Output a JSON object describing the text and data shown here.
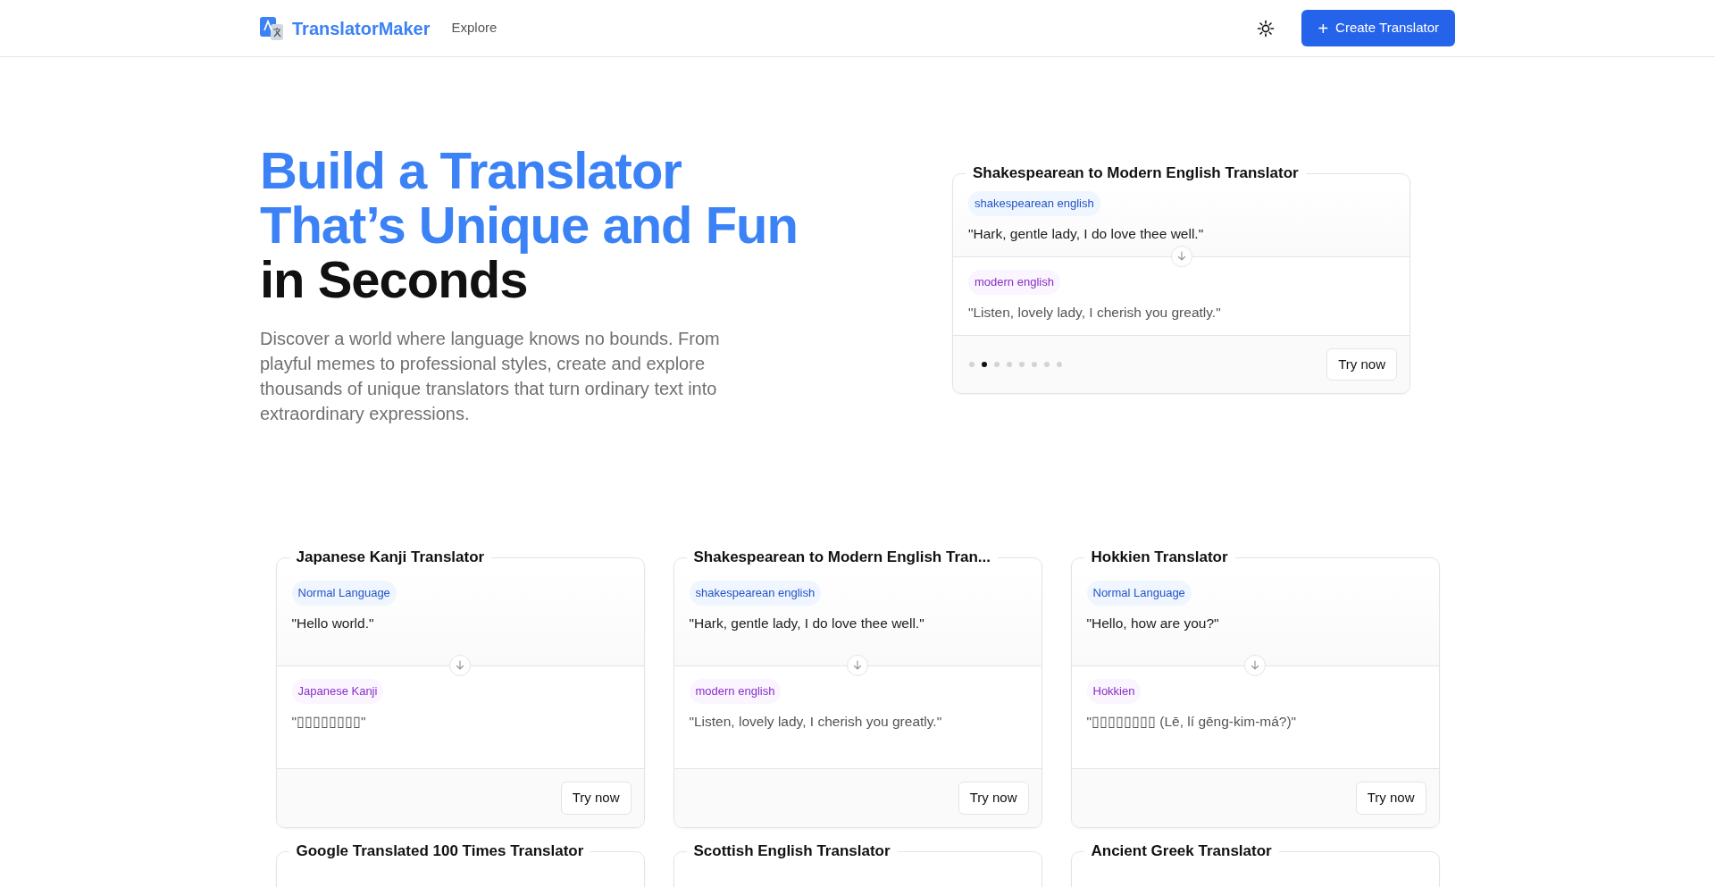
{
  "header": {
    "brand": "TranslatorMaker",
    "nav": [
      {
        "label": "Explore"
      }
    ],
    "create_button": {
      "icon": "+",
      "label": "Create Translator"
    }
  },
  "hero": {
    "title_lines": [
      {
        "text": "Build a Translator",
        "highlight": true
      },
      {
        "text": "That’s Unique and Fun",
        "highlight": true
      },
      {
        "text": "in Seconds",
        "highlight": false
      }
    ],
    "description": "Discover a world where language knows no bounds. From playful memes to professional styles, create and explore thousands of unique translators that turn ordinary text into extraordinary expressions.",
    "featured": {
      "title": "Shakespearean to Modern English Translator",
      "source": {
        "label": "shakespearean english",
        "text": "\"Hark, gentle lady, I do love thee well.\""
      },
      "target": {
        "label": "modern english",
        "text": "\"Listen, lovely lady, I cherish you greatly.\""
      },
      "dots": [
        {
          "selected": false
        },
        {
          "selected": true
        },
        {
          "selected": false
        },
        {
          "selected": false
        },
        {
          "selected": false
        },
        {
          "selected": false
        },
        {
          "selected": false
        },
        {
          "selected": false
        }
      ],
      "button": "Try now"
    }
  },
  "translators": [
    {
      "title": "Japanese Kanji Translator",
      "source": {
        "label": "Normal Language",
        "text": "\"Hello world.\""
      },
      "target": {
        "label": "Japanese Kanji",
        "text": "\"▯▯▯▯▯▯▯▯\""
      },
      "button": "Try now"
    },
    {
      "title": "Shakespearean to Modern English Tran...",
      "source": {
        "label": "shakespearean english",
        "text": "\"Hark, gentle lady, I do love thee well.\""
      },
      "target": {
        "label": "modern english",
        "text": "\"Listen, lovely lady, I cherish you greatly.\""
      },
      "button": "Try now"
    },
    {
      "title": "Hokkien Translator",
      "source": {
        "label": "Normal Language",
        "text": "\"Hello, how are you?\""
      },
      "target": {
        "label": "Hokkien",
        "text": "\"▯▯▯▯▯▯▯▯ (Lē, lí gēng-kim-má?)\""
      },
      "button": "Try now"
    }
  ],
  "more_translators": [
    {
      "title": "Google Translated 100 Times Translator"
    },
    {
      "title": "Scottish English Translator"
    },
    {
      "title": "Ancient Greek Translator"
    }
  ]
}
